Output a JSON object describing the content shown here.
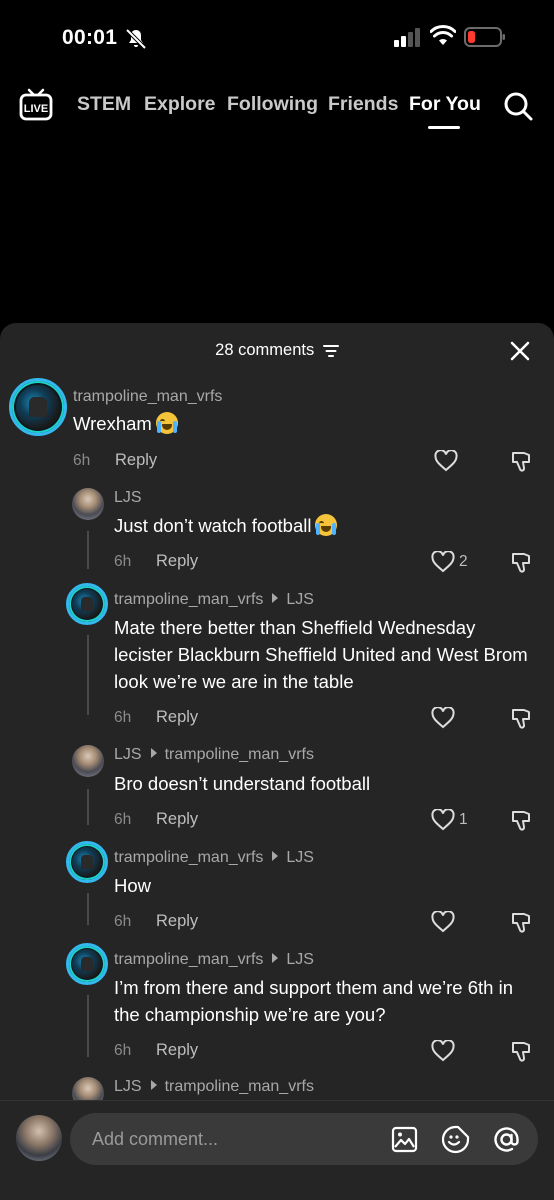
{
  "status_bar": {
    "time": "00:01"
  },
  "top_nav": {
    "tabs": [
      {
        "label": "STEM"
      },
      {
        "label": "Explore"
      },
      {
        "label": "Following"
      },
      {
        "label": "Friends"
      },
      {
        "label": "For You",
        "active": true
      }
    ],
    "live_label": "LIVE"
  },
  "comments_panel": {
    "count_label": "28 comments",
    "comments": [
      {
        "user": "trampoline_man_vrfs",
        "reply_to": "",
        "text": "Wrexham",
        "emoji": "loudly-crying-face",
        "time": "6h",
        "reply_label": "Reply",
        "likes": ""
      },
      {
        "user": "LJS",
        "reply_to": "",
        "text": "Just don’t watch football",
        "emoji": "loudly-crying-face",
        "time": "6h",
        "reply_label": "Reply",
        "likes": "2"
      },
      {
        "user": "trampoline_man_vrfs",
        "reply_to": "LJS",
        "text": "Mate there better than Sheffield Wednesday lecister Blackburn Sheffield United and West Brom look we’re we are in the table",
        "time": "6h",
        "reply_label": "Reply",
        "likes": ""
      },
      {
        "user": "LJS",
        "reply_to": "trampoline_man_vrfs",
        "text": "Bro doesn’t understand football",
        "time": "6h",
        "reply_label": "Reply",
        "likes": "1"
      },
      {
        "user": "trampoline_man_vrfs",
        "reply_to": "LJS",
        "text": "How",
        "time": "6h",
        "reply_label": "Reply",
        "likes": ""
      },
      {
        "user": "trampoline_man_vrfs",
        "reply_to": "LJS",
        "text": "I’m from there and support them and we’re 6th in the championship we’re are you?",
        "time": "6h",
        "reply_label": "Reply",
        "likes": ""
      },
      {
        "user": "LJS",
        "reply_to": "trampoline_man_vrfs",
        "text": "",
        "time": "",
        "reply_label": "",
        "likes": ""
      }
    ]
  },
  "composer": {
    "placeholder": "Add comment..."
  }
}
